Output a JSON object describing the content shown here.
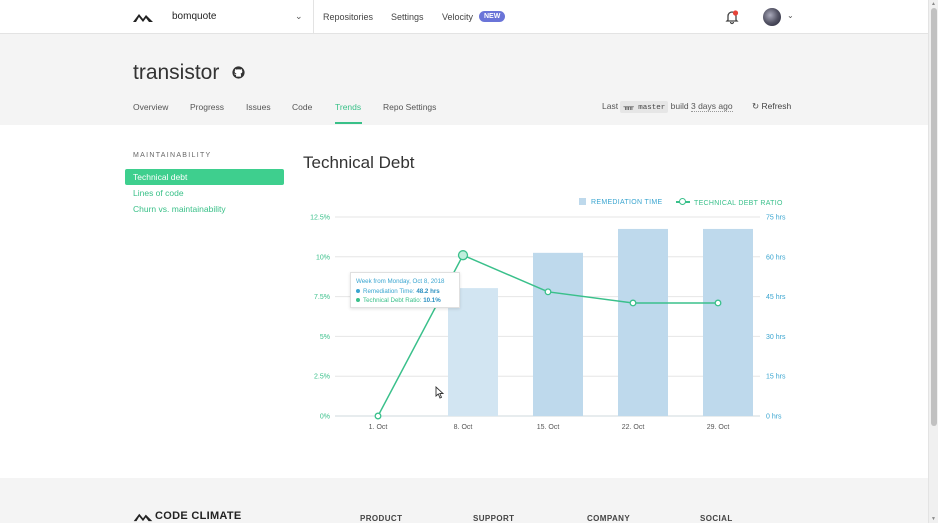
{
  "nav": {
    "org": "bomquote",
    "links": [
      "Repositories",
      "Settings",
      "Velocity"
    ],
    "badge": "NEW",
    "icons": [
      "codeclimate-logo-icon",
      "chevron-down-icon",
      "bell-icon",
      "avatar",
      "chevron-down-icon"
    ]
  },
  "repo": {
    "name": "transistor",
    "tabs": [
      "Overview",
      "Progress",
      "Issues",
      "Code",
      "Trends",
      "Repo Settings"
    ],
    "active_tab": "Trends",
    "last_label": "Last",
    "branch": "master",
    "build_label": "build",
    "build_ago": "3 days ago",
    "refresh": "Refresh"
  },
  "sidebar": {
    "heading": "MAINTAINABILITY",
    "items": [
      "Technical debt",
      "Lines of code",
      "Churn vs. maintainability"
    ],
    "active": "Technical debt"
  },
  "main": {
    "title": "Technical Debt"
  },
  "tooltip": {
    "week": "Week from Monday, Oct 8, 2018",
    "rem_label": "Remediation Time:",
    "rem_value": "48.2 hrs",
    "ratio_label": "Technical Debt Ratio:",
    "ratio_value": "10.1%"
  },
  "chart_data": {
    "type": "bar",
    "categories": [
      "1. Oct",
      "8. Oct",
      "15. Oct",
      "22. Oct",
      "29. Oct"
    ],
    "series": [
      {
        "name": "REMEDIATION TIME",
        "type": "bar",
        "axis": "right",
        "values": [
          0,
          48.2,
          61.5,
          70.5,
          70.5
        ]
      },
      {
        "name": "TECHNICAL DEBT RATIO",
        "type": "line",
        "axis": "left",
        "values": [
          0,
          10.1,
          7.8,
          7.1,
          7.1
        ]
      }
    ],
    "y_left_ticks": [
      "0%",
      "2.5%",
      "5%",
      "7.5%",
      "10%",
      "12.5%"
    ],
    "y_left_range": [
      0,
      12.5
    ],
    "y_right_ticks": [
      "0 hrs",
      "15 hrs",
      "30 hrs",
      "45 hrs",
      "60 hrs",
      "75 hrs"
    ],
    "y_right_range": [
      0,
      75
    ],
    "colors": {
      "bar": "#bed9ec",
      "bar_highlight": "#d2e5f2",
      "line": "#3ac08b",
      "axis_text_left": "#3ac08b",
      "axis_text_right": "#3aa5d0"
    },
    "grid": true,
    "legend": "top-right"
  },
  "footer": {
    "brand": "CODE CLIMATE",
    "columns": [
      "PRODUCT",
      "SUPPORT",
      "COMPANY",
      "SOCIAL"
    ]
  }
}
